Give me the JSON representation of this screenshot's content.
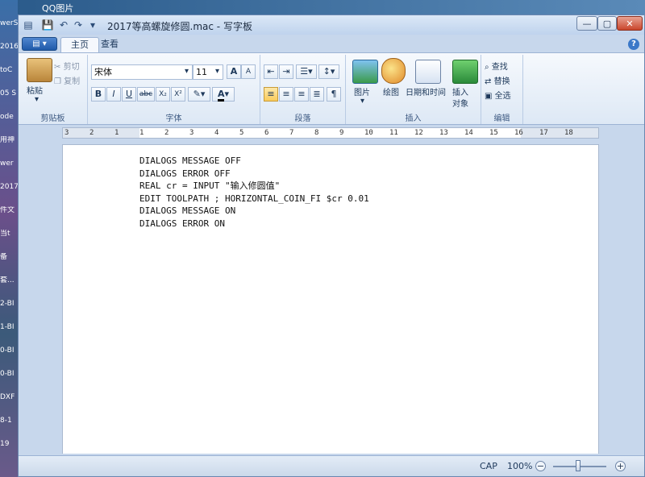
{
  "desktop": {
    "top_label": "QQ图片",
    "items": [
      "werSh",
      "2016",
      "toC",
      "05 S",
      "ode",
      "用神",
      "wer",
      "2017",
      "件文",
      "当t",
      "备",
      "套...",
      "2-BI",
      "1-BI",
      "0-BI",
      "0-BI",
      "DXF",
      "8-1",
      "19"
    ]
  },
  "window": {
    "title": "2017等高螺旋修圆.mac - 写字板",
    "controls": {
      "minimize": "—",
      "maximize": "▢",
      "close": "✕"
    }
  },
  "quick_access": {
    "save": "💾",
    "undo": "↶",
    "redo": "↷",
    "customize": "▾"
  },
  "ribbon": {
    "app_menu": "▤ ▾",
    "tabs": [
      {
        "label": "主页"
      },
      {
        "label": "查看"
      }
    ],
    "help": "?",
    "clipboard": {
      "paste": "粘贴",
      "cut": "剪切",
      "copy": "复制",
      "label": "剪贴板"
    },
    "font": {
      "name": "宋体",
      "size": "11",
      "grow": "A",
      "shrink": "A",
      "bold": "B",
      "italic": "I",
      "underline": "U",
      "strike": "abc",
      "subscript": "X₂",
      "superscript": "X²",
      "highlight": "✎",
      "color": "A",
      "label": "字体"
    },
    "paragraph": {
      "label": "段落"
    },
    "insert": {
      "picture": "图片",
      "paint": "绘图",
      "datetime": "日期和时间",
      "object_line1": "插入",
      "object_line2": "对象",
      "label": "插入"
    },
    "editing": {
      "find": "查找",
      "replace": "替换",
      "select_all": "全选",
      "label": "编辑"
    }
  },
  "ruler": {
    "ticks": [
      "3",
      "2",
      "1",
      "1",
      "2",
      "3",
      "4",
      "5",
      "6",
      "7",
      "8",
      "9",
      "10",
      "11",
      "12",
      "13",
      "14",
      "15",
      "16",
      "17",
      "18"
    ]
  },
  "document": {
    "lines": [
      "DIALOGS MESSAGE OFF",
      "DIALOGS ERROR OFF",
      "REAL cr = INPUT \"输入修圆值\"",
      "EDIT TOOLPATH ; HORIZONTAL_COIN_FI $cr 0.01",
      "DIALOGS MESSAGE ON",
      "DIALOGS ERROR ON"
    ]
  },
  "statusbar": {
    "cap": "CAP",
    "zoom": "100%",
    "zoom_level_percent": 100,
    "zoom_out": "−",
    "zoom_in": "+"
  }
}
